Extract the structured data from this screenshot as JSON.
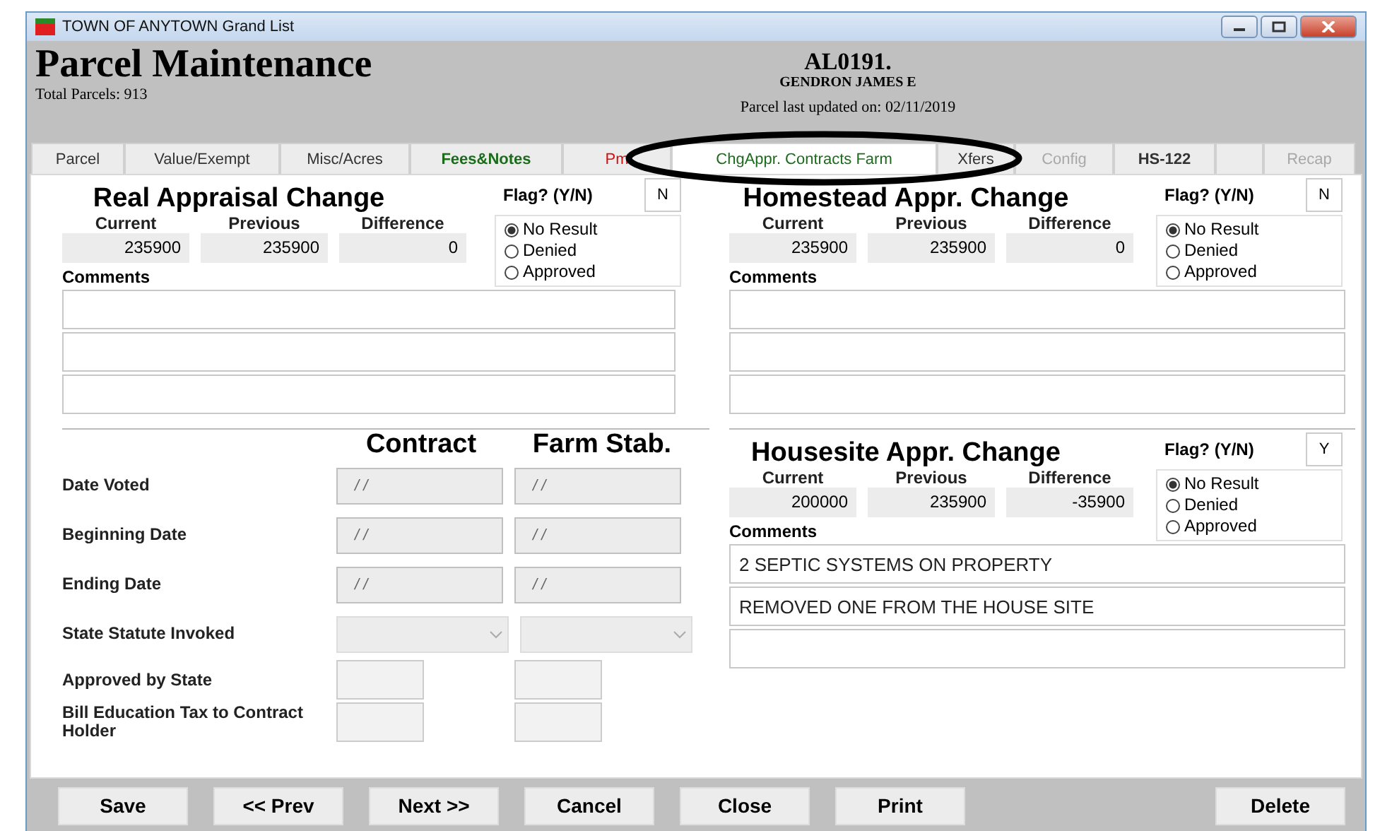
{
  "window": {
    "title": "TOWN OF ANYTOWN Grand List"
  },
  "header": {
    "title": "Parcel Maintenance",
    "total": "Total Parcels: 913",
    "parcel_id": "AL0191.",
    "owner": "GENDRON JAMES E",
    "updated": "Parcel last updated on: 02/11/2019"
  },
  "tabs": [
    {
      "label": "Parcel",
      "selected": false,
      "disabled": false,
      "color": "#333333"
    },
    {
      "label": "Value/Exempt",
      "selected": false,
      "disabled": false,
      "color": "#333333"
    },
    {
      "label": "Misc/Acres",
      "selected": false,
      "disabled": false,
      "color": "#333333"
    },
    {
      "label": "Fees&Notes",
      "selected": false,
      "disabled": false,
      "color": "#1a6b1a"
    },
    {
      "label": "Pm",
      "selected": false,
      "disabled": false,
      "color": "#d01010"
    },
    {
      "label": "ChgAppr. Contracts Farm",
      "selected": true,
      "disabled": false,
      "color": "#1a6b1a"
    },
    {
      "label": "Xfers",
      "selected": false,
      "disabled": false,
      "color": "#333333"
    },
    {
      "label": "Config",
      "selected": false,
      "disabled": true
    },
    {
      "label": "HS-122",
      "selected": false,
      "disabled": false,
      "color": "#333333"
    },
    {
      "label": "Recap",
      "selected": false,
      "disabled": true
    }
  ],
  "appraisals": [
    {
      "title": "Real Appraisal Change",
      "flag_label": "Flag? (Y/N)",
      "flag": "N",
      "current_label": "Current",
      "previous_label": "Previous",
      "difference_label": "Difference",
      "current": "235900",
      "previous": "235900",
      "difference": "0",
      "comments_label": "Comments",
      "results": [
        {
          "label": "No Result",
          "selected": true
        },
        {
          "label": "Denied",
          "selected": false
        },
        {
          "label": "Approved",
          "selected": false
        }
      ]
    },
    {
      "title": "Homestead Appr. Change",
      "flag_label": "Flag? (Y/N)",
      "flag": "N",
      "current_label": "Current",
      "previous_label": "Previous",
      "difference_label": "Difference",
      "current": "235900",
      "previous": "235900",
      "difference": "0",
      "comments_label": "Comments",
      "results": [
        {
          "label": "No Result",
          "selected": true
        },
        {
          "label": "Denied",
          "selected": false
        },
        {
          "label": "Approved",
          "selected": false
        }
      ]
    },
    {
      "title": "Housesite Appr. Change",
      "flag_label": "Flag? (Y/N)",
      "flag": "Y",
      "current_label": "Current",
      "previous_label": "Previous",
      "difference_label": "Difference",
      "current": "200000",
      "previous": "235900",
      "difference": "-35900",
      "comments_label": "Comments",
      "comments": [
        "2 SEPTIC SYSTEMS ON PROPERTY",
        "REMOVED ONE FROM THE HOUSE SITE"
      ],
      "results": [
        {
          "label": "No Result",
          "selected": true
        },
        {
          "label": "Denied",
          "selected": false
        },
        {
          "label": "Approved",
          "selected": false
        }
      ]
    }
  ],
  "contracts": {
    "columns": [
      "Contract",
      "Farm Stab."
    ],
    "rows": [
      {
        "label": "Date Voted",
        "kind": "date",
        "values": [
          "/ /",
          "/ /"
        ]
      },
      {
        "label": "Beginning Date",
        "kind": "date",
        "values": [
          "/ /",
          "/ /"
        ]
      },
      {
        "label": "Ending Date",
        "kind": "date",
        "values": [
          "/ /",
          "/ /"
        ]
      },
      {
        "label": "State Statute Invoked",
        "kind": "select"
      },
      {
        "label": "Approved by State",
        "kind": "small"
      },
      {
        "label": "Bill Education Tax to Contract Holder",
        "kind": "small"
      }
    ]
  },
  "buttons": [
    "Save",
    "<< Prev",
    "Next >>",
    "Cancel",
    "Close",
    "Print"
  ],
  "right_buttons": [
    "Delete"
  ]
}
